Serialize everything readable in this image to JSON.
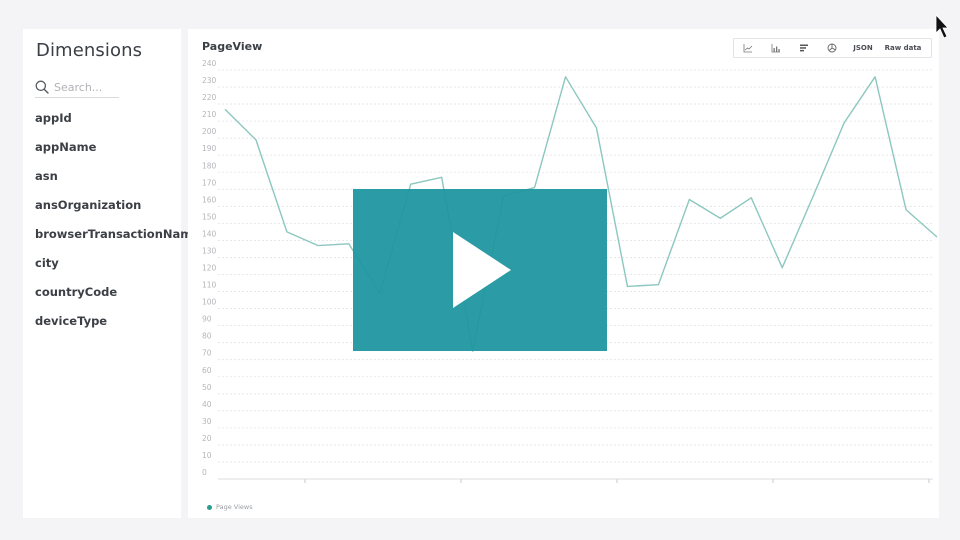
{
  "sidebar": {
    "title": "Dimensions",
    "search_placeholder": "Search...",
    "items": [
      {
        "label": "appId"
      },
      {
        "label": "appName"
      },
      {
        "label": "asn"
      },
      {
        "label": "ansOrganization"
      },
      {
        "label": "browserTransactionName"
      },
      {
        "label": "city"
      },
      {
        "label": "countryCode"
      },
      {
        "label": "deviceType"
      }
    ]
  },
  "panel": {
    "title": "PageView",
    "toolbar": {
      "icons": [
        "line-chart-icon",
        "area-chart-icon",
        "bar-chart-icon",
        "pie-chart-icon"
      ],
      "json_label": "JSON",
      "raw_label": "Raw data"
    }
  },
  "video": {
    "play_icon": "play-icon",
    "overlay_color": "#1e96a0"
  },
  "colors": {
    "line": "#8cc7bf",
    "legend_dot": "#2a9d8f",
    "grid": "#e3e4e7"
  },
  "chart_data": {
    "type": "line",
    "title": "PageView",
    "xlabel": "",
    "ylabel": "",
    "ylim": [
      0,
      240
    ],
    "yticks": [
      0,
      10,
      20,
      30,
      40,
      50,
      60,
      70,
      80,
      90,
      100,
      110,
      120,
      130,
      140,
      150,
      160,
      170,
      180,
      190,
      200,
      210,
      220,
      230,
      240
    ],
    "grid": true,
    "legend_position": "bottom-left",
    "x_tick_count": 5,
    "series": [
      {
        "name": "Page Views",
        "values": [
          217,
          199,
          145,
          137,
          138,
          109,
          173,
          177,
          75,
          166,
          171,
          236,
          206,
          113,
          114,
          164,
          153,
          165,
          124,
          166,
          209,
          236,
          158,
          142
        ]
      }
    ]
  }
}
